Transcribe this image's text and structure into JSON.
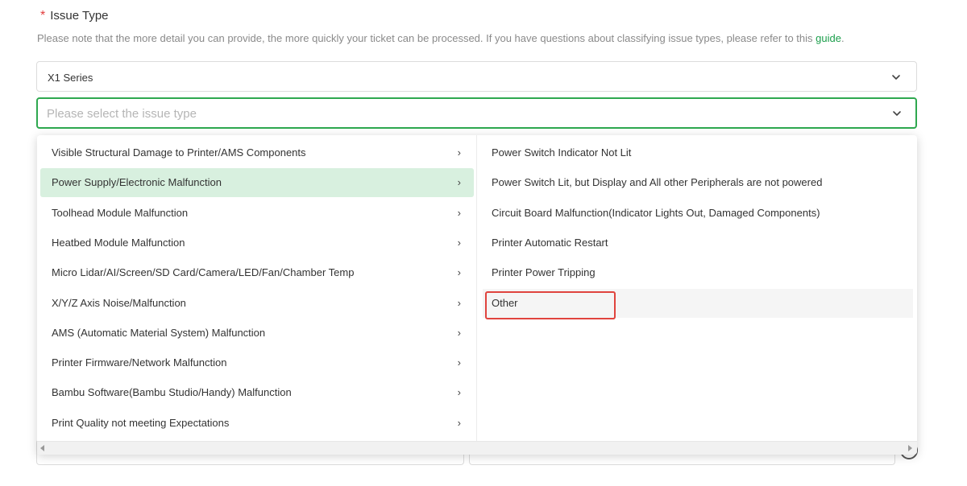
{
  "field": {
    "required_mark": "*",
    "label": "Issue Type",
    "hint_text": "Please note that the more detail you can provide, the more quickly your ticket can be processed. If you have questions about classifying issue types, please refer to this ",
    "hint_link": "guide",
    "hint_end": "."
  },
  "series_select": {
    "value": "X1 Series"
  },
  "issue_select": {
    "placeholder": "Please select the issue type"
  },
  "categories": [
    {
      "label": "Visible Structural Damage to Printer/AMS Components"
    },
    {
      "label": "Power Supply/Electronic Malfunction",
      "active": true
    },
    {
      "label": "Toolhead Module Malfunction"
    },
    {
      "label": "Heatbed Module Malfunction"
    },
    {
      "label": "Micro Lidar/AI/Screen/SD Card/Camera/LED/Fan/Chamber Temp"
    },
    {
      "label": "X/Y/Z Axis Noise/Malfunction"
    },
    {
      "label": "AMS (Automatic Material System) Malfunction"
    },
    {
      "label": "Printer Firmware/Network Malfunction"
    },
    {
      "label": "Bambu Software(Bambu Studio/Handy) Malfunction"
    },
    {
      "label": "Print Quality not meeting Expectations"
    }
  ],
  "subcategories": [
    {
      "label": "Power Switch Indicator Not Lit"
    },
    {
      "label": "Power Switch Lit, but Display and All other Peripherals are not powered"
    },
    {
      "label": "Circuit Board Malfunction(Indicator Lights Out, Damaged Components)"
    },
    {
      "label": "Printer Automatic Restart"
    },
    {
      "label": "Printer Power Tripping"
    },
    {
      "label": "Other",
      "hover": true
    }
  ],
  "icons": {
    "arrow_glyph": "›",
    "chevron": "chevron-down-icon",
    "submenu": "chevron-right-icon"
  },
  "colors": {
    "accent": "#2ea84f",
    "link": "#1b9e4b",
    "active_bg": "#d8f0df",
    "required": "#e23c3c",
    "highlight": "#e0443e"
  }
}
